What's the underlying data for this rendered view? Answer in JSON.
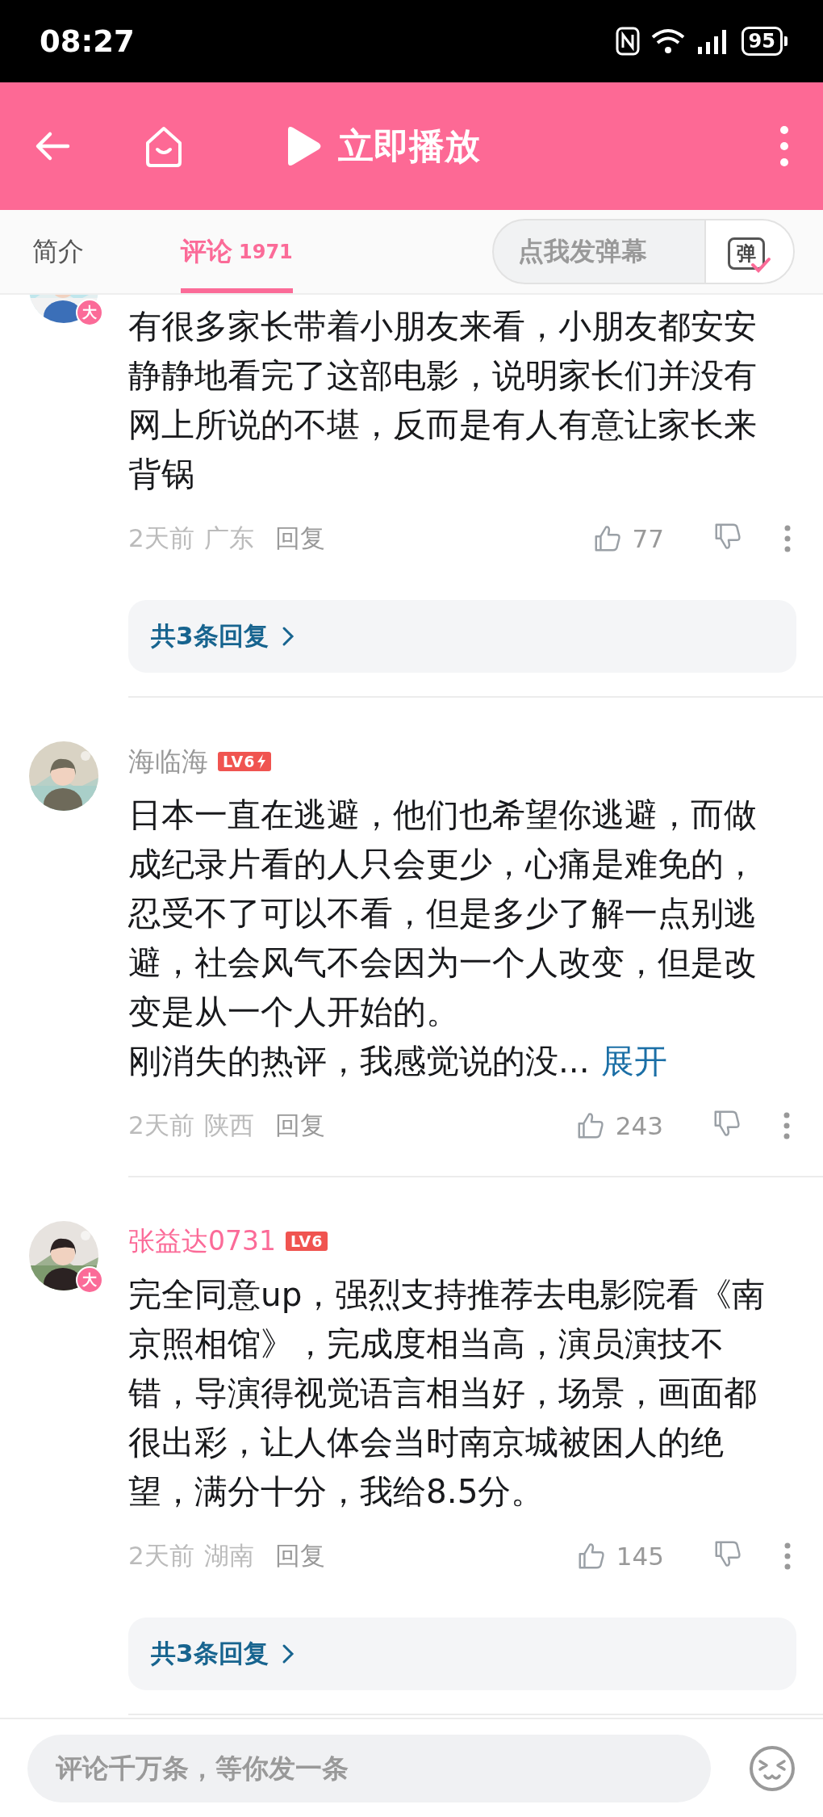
{
  "status_bar": {
    "time": "08:27",
    "battery": "95"
  },
  "header": {
    "title": "立即播放"
  },
  "tabs": [
    {
      "label": "简介",
      "selected": false
    },
    {
      "label": "评论",
      "count": "1971",
      "selected": true
    }
  ],
  "danmaku": {
    "label": "点我发弹幕",
    "icon_label": "弹"
  },
  "comments": [
    {
      "avatar_badge": "大",
      "text": "有很多家长带着小朋友来看，小朋友都安安静静地看完了这部电影，说明家长们并没有网上所说的不堪，反而是有人有意让家长来背锅",
      "time": "2天前",
      "location": "广东",
      "reply": "回复",
      "likes": "77",
      "replies": "共3条回复"
    },
    {
      "user": "海临海",
      "vip": false,
      "rank": "LV6",
      "rank_bolt": true,
      "text": "日本一直在逃避，他们也希望你逃避，而做成纪录片看的人只会更少，心痛是难免的，忍受不了可以不看，但是多少了解一点别逃避，社会风气不会因为一个人改变，但是改变是从一个人开始的。",
      "text_more": "刚消失的热评，我感觉说的没...",
      "expand": "展开",
      "time": "2天前",
      "location": "陕西",
      "reply": "回复",
      "likes": "243"
    },
    {
      "user": "张益达0731",
      "vip": true,
      "rank": "LV6",
      "rank_bolt": false,
      "avatar_badge": "大",
      "text": "完全同意up，强烈支持推荐去电影院看《南京照相馆》，完成度相当高，演员演技不错，导演得视觉语言相当好，场景，画面都很出彩，让人体会当时南京城被困人的绝望，满分十分，我给8.5分。",
      "time": "2天前",
      "location": "湖南",
      "reply": "回复",
      "likes": "145",
      "replies": "共3条回复"
    }
  ],
  "composer": {
    "placeholder": "评论千万条，等你发一条"
  }
}
